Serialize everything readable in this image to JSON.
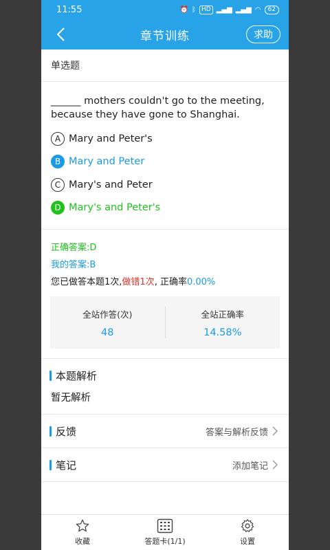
{
  "status": {
    "time": "11:55",
    "network": "HD",
    "battery": "62"
  },
  "header": {
    "title": "章节训练",
    "help_label": "求助"
  },
  "question": {
    "type": "单选题",
    "text": "______ mothers couldn't go to the meeting, because they have gone to Shanghai.",
    "options": [
      {
        "letter": "A",
        "text": "Mary and Peter's",
        "state": "normal"
      },
      {
        "letter": "B",
        "text": "Mary and Peter",
        "state": "selected-wrong"
      },
      {
        "letter": "C",
        "text": "Mary's and Peter",
        "state": "normal"
      },
      {
        "letter": "D",
        "text": "Mary's and Peter's",
        "state": "correct"
      }
    ]
  },
  "answers": {
    "correct_label": "正确答案:D",
    "mine_label": "我的答案:B",
    "stats_prefix": "您已做答本题1次,",
    "stats_wrong": "做错1次",
    "stats_mid": ", 正确率",
    "stats_rate": "0.00%"
  },
  "site_stats": {
    "attempts_label": "全站作答(次)",
    "attempts_value": "48",
    "rate_label": "全站正确率",
    "rate_value": "14.58%"
  },
  "analysis": {
    "title": "本题解析",
    "body": "暂无解析"
  },
  "feedback": {
    "title": "反馈",
    "action": "答案与解析反馈"
  },
  "notes": {
    "title": "笔记",
    "action": "添加笔记"
  },
  "tabbar": {
    "favorite": "收藏",
    "answer_card": "答题卡(1/1)",
    "settings": "设置"
  },
  "colors": {
    "primary": "#29a3e8",
    "correct": "#21c21e",
    "wrong": "#e0352b",
    "accent": "#1a9be6"
  }
}
